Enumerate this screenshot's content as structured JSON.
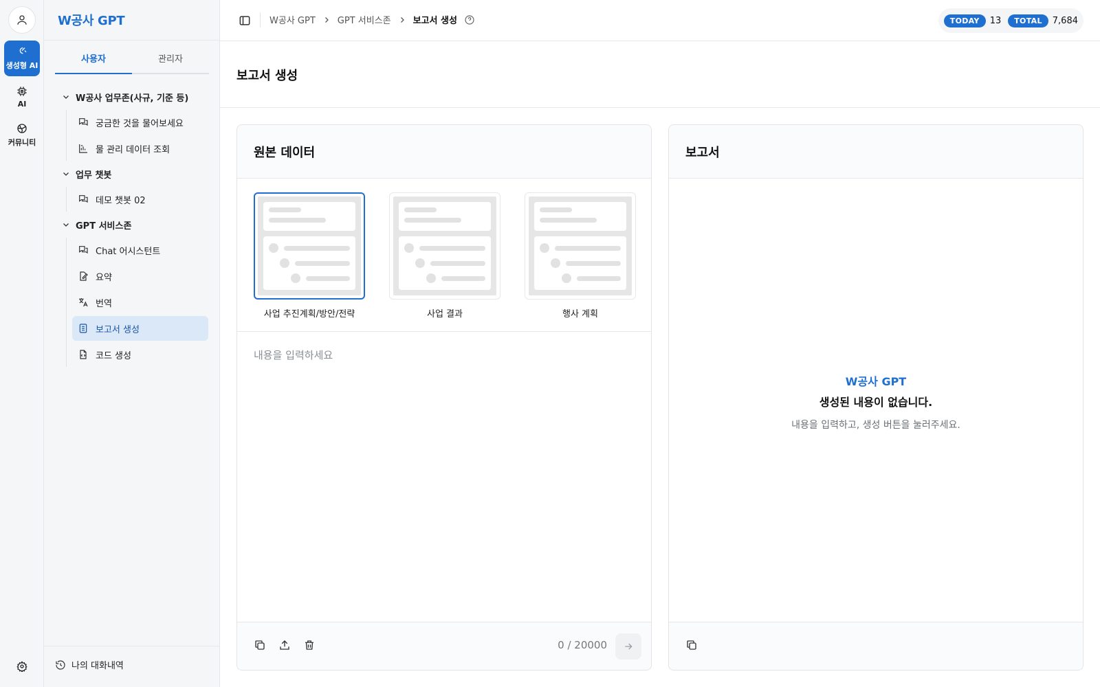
{
  "app": {
    "brand": "W공사 GPT"
  },
  "rail": {
    "items": [
      {
        "label": "생성형 AI",
        "icon": "sparkle-brain-icon",
        "active": true
      },
      {
        "label": "AI",
        "icon": "chip-icon",
        "active": false
      },
      {
        "label": "커뮤니티",
        "icon": "globe-icon",
        "active": false
      }
    ],
    "avatar_icon": "user-icon",
    "settings_icon": "gear-icon"
  },
  "sidebar": {
    "tabs": [
      {
        "label": "사용자",
        "active": true
      },
      {
        "label": "관리자",
        "active": false
      }
    ],
    "groups": [
      {
        "label": "W공사 업무존(사규, 기준 등)",
        "items": [
          {
            "label": "궁금한 것을 물어보세요",
            "icon": "chat-bubbles-icon"
          },
          {
            "label": "물 관리 데이터 조회",
            "icon": "data-chart-icon"
          }
        ]
      },
      {
        "label": "업무 챗봇",
        "items": [
          {
            "label": "데모 챗봇 02",
            "icon": "chat-bubbles-icon"
          }
        ]
      },
      {
        "label": "GPT 서비스존",
        "items": [
          {
            "label": "Chat 어시스턴트",
            "icon": "chat-bubbles-icon"
          },
          {
            "label": "요약",
            "icon": "edit-document-icon"
          },
          {
            "label": "번역",
            "icon": "translate-icon"
          },
          {
            "label": "보고서 생성",
            "icon": "report-icon",
            "active": true
          },
          {
            "label": "코드 생성",
            "icon": "code-file-icon"
          }
        ]
      }
    ],
    "history_label": "나의 대화내역"
  },
  "header": {
    "breadcrumb": [
      "W공사 GPT",
      "GPT 서비스존",
      "보고서 생성"
    ],
    "today_label": "TODAY",
    "today_count": "13",
    "total_label": "TOTAL",
    "total_count": "7,684"
  },
  "page": {
    "title": "보고서 생성"
  },
  "source_panel": {
    "title": "원본 데이터",
    "templates": [
      {
        "label": "사업 추진계획/방안/전략",
        "active": true
      },
      {
        "label": "사업 결과",
        "active": false
      },
      {
        "label": "행사 계획",
        "active": false
      }
    ],
    "input_placeholder": "내용을 입력하세요",
    "input_value": "",
    "char_count": "0 / 20000"
  },
  "report_panel": {
    "title": "보고서",
    "empty_brand": "W공사 GPT",
    "empty_title": "생성된 내용이 없습니다.",
    "empty_sub": "내용을 입력하고, 생성 버튼을 눌러주세요."
  },
  "colors": {
    "accent": "#1f6fd1",
    "active_bg": "#dbe8f8",
    "rail_bg": "#f5f6f7"
  }
}
